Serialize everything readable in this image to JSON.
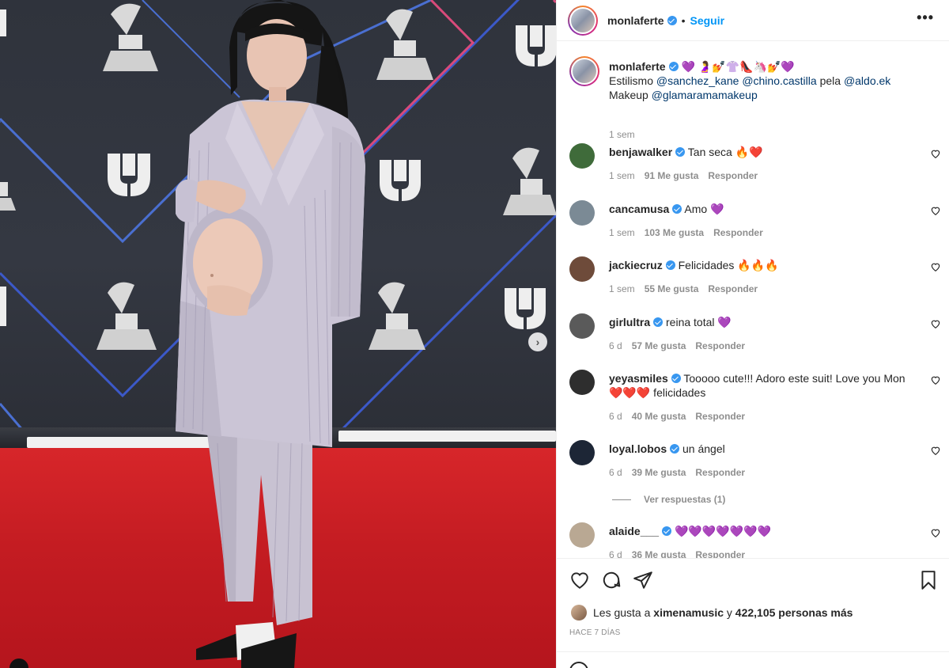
{
  "post": {
    "author": "monlaferte",
    "follow_label": "Seguir",
    "separator": "•",
    "more_label": "•••"
  },
  "caption": {
    "username": "monlaferte",
    "emojis": "💜 🤰💅👚👠🦄💅💜",
    "line1_prefix": "Estilismo ",
    "mention1": "@sanchez_kane",
    "mention2": "@chino.castilla",
    "middle": " pela ",
    "mention3": "@aldo.ek",
    "line2_prefix": "Makeup ",
    "mention4": "@glamaramamakeup",
    "time": "1 sem"
  },
  "comments": [
    {
      "user": "benjawalker",
      "text": "Tan seca 🔥❤️",
      "time": "1 sem",
      "likes": "91 Me gusta",
      "reply": "Responder",
      "avatar_color": "#3f6b3a"
    },
    {
      "user": "cancamusa",
      "text": "Amo 💜",
      "time": "1 sem",
      "likes": "103 Me gusta",
      "reply": "Responder",
      "avatar_color": "#7b8a95"
    },
    {
      "user": "jackiecruz",
      "text": "Felicidades 🔥🔥🔥",
      "time": "1 sem",
      "likes": "55 Me gusta",
      "reply": "Responder",
      "avatar_color": "#6e4b3a"
    },
    {
      "user": "girlultra",
      "text": "reina total 💜",
      "time": "6 d",
      "likes": "57 Me gusta",
      "reply": "Responder",
      "avatar_color": "#5a5a5a"
    },
    {
      "user": "yeyasmiles",
      "text": "Tooooo cute!!! Adoro este suit! Love you Mon ❤️❤️❤️ felicidades",
      "time": "6 d",
      "likes": "40 Me gusta",
      "reply": "Responder",
      "avatar_color": "#2e2e2e"
    },
    {
      "user": "loyal.lobos",
      "text": "un ángel",
      "time": "6 d",
      "likes": "39 Me gusta",
      "reply": "Responder",
      "avatar_color": "#1d2636"
    },
    {
      "user": "alaide___",
      "text": "💜💜💜💜💜💜💜",
      "time": "6 d",
      "likes": "36 Me gusta",
      "reply": "Responder",
      "avatar_color": "#b9a893"
    }
  ],
  "view_replies": "Ver respuestas (1)",
  "likes": {
    "prefix": "Les gusta a ",
    "user": "ximenamusic",
    "middle": " y ",
    "count": "422,105 personas más"
  },
  "timestamp": "HACE 7 DÍAS",
  "photo": {
    "next_icon": "chevron-right-icon",
    "next_glyph": "›"
  },
  "colors": {
    "link": "#0095f6",
    "mention": "#00376b",
    "muted": "#8e8e8e",
    "carpet": "#c41c22",
    "backdrop": "#30343d"
  }
}
